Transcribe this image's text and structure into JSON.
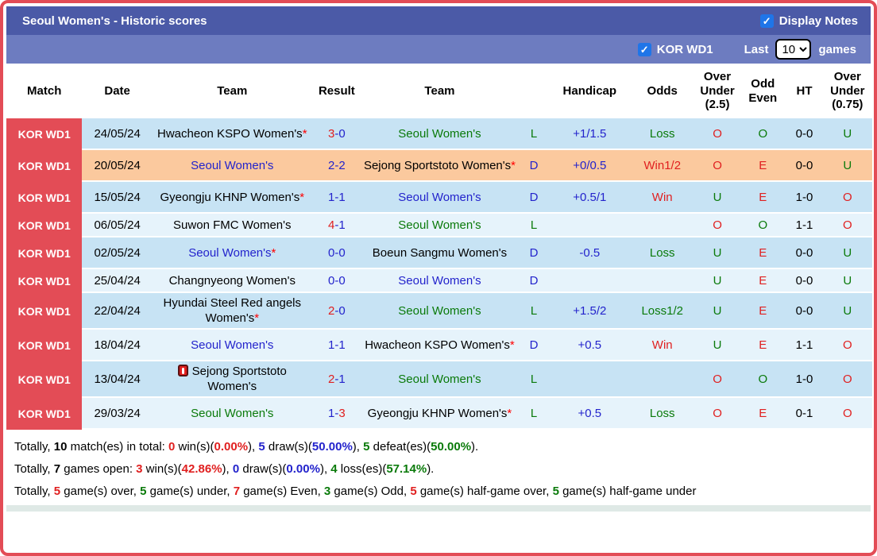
{
  "title_bar": {
    "title": "Seoul Women's - Historic scores",
    "display_notes_label": "Display Notes",
    "display_notes_checked": true
  },
  "filter_bar": {
    "league_label": "KOR WD1",
    "league_checked": true,
    "last_label": "Last",
    "games_count": "10",
    "games_label": "games"
  },
  "colors": {
    "accent_red": "#e34c56",
    "title_bar": "#4b5aa7",
    "filter_bar": "#6d7cc0",
    "row_blue": "#c7e3f4",
    "row_light": "#e6f3fb",
    "row_highlight_orange": "#fbc99e",
    "checkbox_blue": "#1f75e8",
    "text_red": "#e01f1f",
    "text_blue": "#2323cc",
    "text_green": "#0a7a0a"
  },
  "table": {
    "asterisk": "*",
    "score_separator": "-",
    "columns": [
      {
        "key": "match",
        "label": "Match"
      },
      {
        "key": "date",
        "label": "Date"
      },
      {
        "key": "home",
        "label": "Team"
      },
      {
        "key": "result",
        "label": "Result"
      },
      {
        "key": "away",
        "label": "Team"
      },
      {
        "key": "wdl",
        "label": ""
      },
      {
        "key": "handicap",
        "label": "Handicap"
      },
      {
        "key": "odds",
        "label": "Odds"
      },
      {
        "key": "ou25",
        "label": "Over Under (2.5)"
      },
      {
        "key": "oddeven",
        "label": "Odd Even"
      },
      {
        "key": "ht",
        "label": "HT"
      },
      {
        "key": "ou075",
        "label": "Over Under (0.75)"
      }
    ],
    "rows": [
      {
        "league": "KOR WD1",
        "date": "24/05/24",
        "bg": "blue",
        "short": false,
        "home": {
          "name": "Hwacheon KSPO Women's",
          "color": "black",
          "star": true,
          "icon": false
        },
        "score": {
          "h": "3",
          "a": "0",
          "hc": "red",
          "ac": "blue"
        },
        "away": {
          "name": "Seoul Women's",
          "color": "green",
          "star": false,
          "icon": false
        },
        "wdl": {
          "t": "L",
          "c": "green"
        },
        "handicap": "+1/1.5",
        "odds": {
          "t": "Loss",
          "c": "green"
        },
        "ou25": {
          "t": "O",
          "c": "red"
        },
        "oddeven": {
          "t": "O",
          "c": "green"
        },
        "ht": "0-0",
        "ou075": {
          "t": "U",
          "c": "green"
        }
      },
      {
        "league": "KOR WD1",
        "date": "20/05/24",
        "bg": "orange",
        "short": false,
        "home": {
          "name": "Seoul Women's",
          "color": "blue",
          "star": false,
          "icon": false
        },
        "score": {
          "h": "2",
          "a": "2",
          "hc": "blue",
          "ac": "blue"
        },
        "away": {
          "name": "Sejong Sportstoto Women's",
          "color": "black",
          "star": true,
          "icon": false
        },
        "wdl": {
          "t": "D",
          "c": "blue"
        },
        "handicap": "+0/0.5",
        "odds": {
          "t": "Win1/2",
          "c": "red"
        },
        "ou25": {
          "t": "O",
          "c": "red"
        },
        "oddeven": {
          "t": "E",
          "c": "red"
        },
        "ht": "0-0",
        "ou075": {
          "t": "U",
          "c": "green"
        }
      },
      {
        "league": "KOR WD1",
        "date": "15/05/24",
        "bg": "blue",
        "short": false,
        "home": {
          "name": "Gyeongju KHNP Women's",
          "color": "black",
          "star": true,
          "icon": false
        },
        "score": {
          "h": "1",
          "a": "1",
          "hc": "blue",
          "ac": "blue"
        },
        "away": {
          "name": "Seoul Women's",
          "color": "blue",
          "star": false,
          "icon": false
        },
        "wdl": {
          "t": "D",
          "c": "blue"
        },
        "handicap": "+0.5/1",
        "odds": {
          "t": "Win",
          "c": "red"
        },
        "ou25": {
          "t": "U",
          "c": "green"
        },
        "oddeven": {
          "t": "E",
          "c": "red"
        },
        "ht": "1-0",
        "ou075": {
          "t": "O",
          "c": "red"
        }
      },
      {
        "league": "KOR WD1",
        "date": "06/05/24",
        "bg": "light",
        "short": true,
        "home": {
          "name": "Suwon FMC Women's",
          "color": "black",
          "star": false,
          "icon": false
        },
        "score": {
          "h": "4",
          "a": "1",
          "hc": "red",
          "ac": "blue"
        },
        "away": {
          "name": "Seoul Women's",
          "color": "green",
          "star": false,
          "icon": false
        },
        "wdl": {
          "t": "L",
          "c": "green"
        },
        "handicap": "",
        "odds": {
          "t": "",
          "c": "black"
        },
        "ou25": {
          "t": "O",
          "c": "red"
        },
        "oddeven": {
          "t": "O",
          "c": "green"
        },
        "ht": "1-1",
        "ou075": {
          "t": "O",
          "c": "red"
        }
      },
      {
        "league": "KOR WD1",
        "date": "02/05/24",
        "bg": "blue",
        "short": false,
        "home": {
          "name": "Seoul Women's",
          "color": "blue",
          "star": true,
          "icon": false
        },
        "score": {
          "h": "0",
          "a": "0",
          "hc": "blue",
          "ac": "blue"
        },
        "away": {
          "name": "Boeun Sangmu Women's",
          "color": "black",
          "star": false,
          "icon": false
        },
        "wdl": {
          "t": "D",
          "c": "blue"
        },
        "handicap": "-0.5",
        "odds": {
          "t": "Loss",
          "c": "green"
        },
        "ou25": {
          "t": "U",
          "c": "green"
        },
        "oddeven": {
          "t": "E",
          "c": "red"
        },
        "ht": "0-0",
        "ou075": {
          "t": "U",
          "c": "green"
        }
      },
      {
        "league": "KOR WD1",
        "date": "25/04/24",
        "bg": "light",
        "short": true,
        "home": {
          "name": "Changnyeong Women's",
          "color": "black",
          "star": false,
          "icon": false
        },
        "score": {
          "h": "0",
          "a": "0",
          "hc": "blue",
          "ac": "blue"
        },
        "away": {
          "name": "Seoul Women's",
          "color": "blue",
          "star": false,
          "icon": false
        },
        "wdl": {
          "t": "D",
          "c": "blue"
        },
        "handicap": "",
        "odds": {
          "t": "",
          "c": "black"
        },
        "ou25": {
          "t": "U",
          "c": "green"
        },
        "oddeven": {
          "t": "E",
          "c": "red"
        },
        "ht": "0-0",
        "ou075": {
          "t": "U",
          "c": "green"
        }
      },
      {
        "league": "KOR WD1",
        "date": "22/04/24",
        "bg": "blue",
        "short": false,
        "home": {
          "name": "Hyundai Steel Red angels Women's",
          "color": "black",
          "star": true,
          "icon": false
        },
        "score": {
          "h": "2",
          "a": "0",
          "hc": "red",
          "ac": "blue"
        },
        "away": {
          "name": "Seoul Women's",
          "color": "green",
          "star": false,
          "icon": false
        },
        "wdl": {
          "t": "L",
          "c": "green"
        },
        "handicap": "+1.5/2",
        "odds": {
          "t": "Loss1/2",
          "c": "green"
        },
        "ou25": {
          "t": "U",
          "c": "green"
        },
        "oddeven": {
          "t": "E",
          "c": "red"
        },
        "ht": "0-0",
        "ou075": {
          "t": "U",
          "c": "green"
        }
      },
      {
        "league": "KOR WD1",
        "date": "18/04/24",
        "bg": "light",
        "short": false,
        "home": {
          "name": "Seoul Women's",
          "color": "blue",
          "star": false,
          "icon": false
        },
        "score": {
          "h": "1",
          "a": "1",
          "hc": "blue",
          "ac": "blue"
        },
        "away": {
          "name": "Hwacheon KSPO Women's",
          "color": "black",
          "star": true,
          "icon": false
        },
        "wdl": {
          "t": "D",
          "c": "blue"
        },
        "handicap": "+0.5",
        "odds": {
          "t": "Win",
          "c": "red"
        },
        "ou25": {
          "t": "U",
          "c": "green"
        },
        "oddeven": {
          "t": "E",
          "c": "red"
        },
        "ht": "1-1",
        "ou075": {
          "t": "O",
          "c": "red"
        }
      },
      {
        "league": "KOR WD1",
        "date": "13/04/24",
        "bg": "blue",
        "short": false,
        "home": {
          "name": "Sejong Sportstoto Women's",
          "color": "black",
          "star": false,
          "icon": true
        },
        "score": {
          "h": "2",
          "a": "1",
          "hc": "red",
          "ac": "blue"
        },
        "away": {
          "name": "Seoul Women's",
          "color": "green",
          "star": false,
          "icon": false
        },
        "wdl": {
          "t": "L",
          "c": "green"
        },
        "handicap": "",
        "odds": {
          "t": "",
          "c": "black"
        },
        "ou25": {
          "t": "O",
          "c": "red"
        },
        "oddeven": {
          "t": "O",
          "c": "green"
        },
        "ht": "1-0",
        "ou075": {
          "t": "O",
          "c": "red"
        }
      },
      {
        "league": "KOR WD1",
        "date": "29/03/24",
        "bg": "light",
        "short": false,
        "home": {
          "name": "Seoul Women's",
          "color": "green",
          "star": false,
          "icon": false
        },
        "score": {
          "h": "1",
          "a": "3",
          "hc": "blue",
          "ac": "red"
        },
        "away": {
          "name": "Gyeongju KHNP Women's",
          "color": "black",
          "star": true,
          "icon": false
        },
        "wdl": {
          "t": "L",
          "c": "green"
        },
        "handicap": "+0.5",
        "odds": {
          "t": "Loss",
          "c": "green"
        },
        "ou25": {
          "t": "O",
          "c": "red"
        },
        "oddeven": {
          "t": "E",
          "c": "red"
        },
        "ht": "0-1",
        "ou075": {
          "t": "O",
          "c": "red"
        }
      }
    ]
  },
  "summary": {
    "lines": [
      [
        {
          "t": "Totally, "
        },
        {
          "t": "10",
          "b": true
        },
        {
          "t": " match(es) in total: "
        },
        {
          "t": "0",
          "c": "red",
          "b": true
        },
        {
          "t": " win(s)("
        },
        {
          "t": "0.00%",
          "c": "red",
          "b": true
        },
        {
          "t": "), "
        },
        {
          "t": "5",
          "c": "blue",
          "b": true
        },
        {
          "t": " draw(s)("
        },
        {
          "t": "50.00%",
          "c": "blue",
          "b": true
        },
        {
          "t": "), "
        },
        {
          "t": "5",
          "c": "green",
          "b": true
        },
        {
          "t": " defeat(es)("
        },
        {
          "t": "50.00%",
          "c": "green",
          "b": true
        },
        {
          "t": ")."
        }
      ],
      [
        {
          "t": "Totally, "
        },
        {
          "t": "7",
          "b": true
        },
        {
          "t": " games open: "
        },
        {
          "t": "3",
          "c": "red",
          "b": true
        },
        {
          "t": " win(s)("
        },
        {
          "t": "42.86%",
          "c": "red",
          "b": true
        },
        {
          "t": "), "
        },
        {
          "t": "0",
          "c": "blue",
          "b": true
        },
        {
          "t": " draw(s)("
        },
        {
          "t": "0.00%",
          "c": "blue",
          "b": true
        },
        {
          "t": "), "
        },
        {
          "t": "4",
          "c": "green",
          "b": true
        },
        {
          "t": " loss(es)("
        },
        {
          "t": "57.14%",
          "c": "green",
          "b": true
        },
        {
          "t": ")."
        }
      ],
      [
        {
          "t": "Totally, "
        },
        {
          "t": "5",
          "c": "red",
          "b": true
        },
        {
          "t": " game(s) over, "
        },
        {
          "t": "5",
          "c": "green",
          "b": true
        },
        {
          "t": " game(s) under, "
        },
        {
          "t": "7",
          "c": "red",
          "b": true
        },
        {
          "t": " game(s) Even, "
        },
        {
          "t": "3",
          "c": "green",
          "b": true
        },
        {
          "t": " game(s) Odd, "
        },
        {
          "t": "5",
          "c": "red",
          "b": true
        },
        {
          "t": " game(s) half-game over, "
        },
        {
          "t": "5",
          "c": "green",
          "b": true
        },
        {
          "t": " game(s) half-game under"
        }
      ]
    ]
  }
}
